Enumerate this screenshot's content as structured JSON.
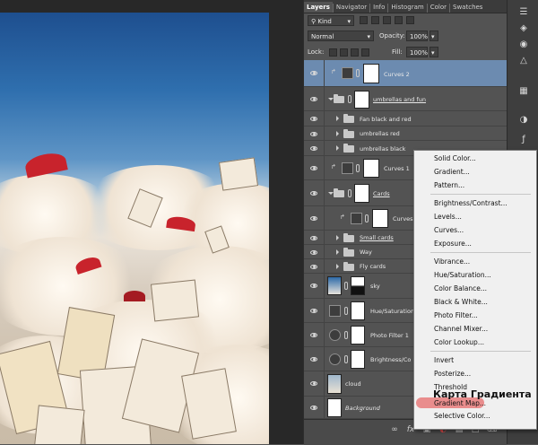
{
  "tabs": [
    "Layers",
    "Navigator",
    "Info",
    "Histogram",
    "Color",
    "Swatches"
  ],
  "filter": {
    "kind_label": "Kind"
  },
  "blend_mode": "Normal",
  "opacity": {
    "label": "Opacity:",
    "value": "100%"
  },
  "lock": {
    "label": "Lock:"
  },
  "fill": {
    "label": "Fill:",
    "value": "100%"
  },
  "layers": [
    {
      "name": "Curves 2",
      "selected": true
    },
    {
      "name": "umbrellas and fun"
    },
    {
      "name": "Fan black and red"
    },
    {
      "name": "umbrellas red"
    },
    {
      "name": "umbrellas black"
    },
    {
      "name": "Curves 1"
    },
    {
      "name": "Cards"
    },
    {
      "name": "Curves"
    },
    {
      "name": "Small cards"
    },
    {
      "name": "Way"
    },
    {
      "name": "Fly cards"
    },
    {
      "name": "sky"
    },
    {
      "name": "Hue/Saturation"
    },
    {
      "name": "Photo Filter 1"
    },
    {
      "name": "Brightness/Co"
    },
    {
      "name": "cloud"
    },
    {
      "name": "Background"
    }
  ],
  "adjustment_menu": [
    "Solid Color...",
    "Gradient...",
    "Pattern...",
    "Brightness/Contrast...",
    "Levels...",
    "Curves...",
    "Exposure...",
    "Vibrance...",
    "Hue/Saturation...",
    "Color Balance...",
    "Black & White...",
    "Photo Filter...",
    "Channel Mixer...",
    "Color Lookup...",
    "Invert",
    "Posterize...",
    "Threshold",
    "Gradient Map...",
    "Selective Color..."
  ],
  "annotation": "Карта Градиента",
  "bottom_icons": [
    "link-icon",
    "fx-icon",
    "mask-icon",
    "adjustment-icon",
    "folder-icon",
    "new-layer-icon",
    "trash-icon"
  ],
  "colors": {
    "selected_layer": "#6c8bb0",
    "highlight": "#e87b7b",
    "umbrella_red": "#c8232c"
  }
}
